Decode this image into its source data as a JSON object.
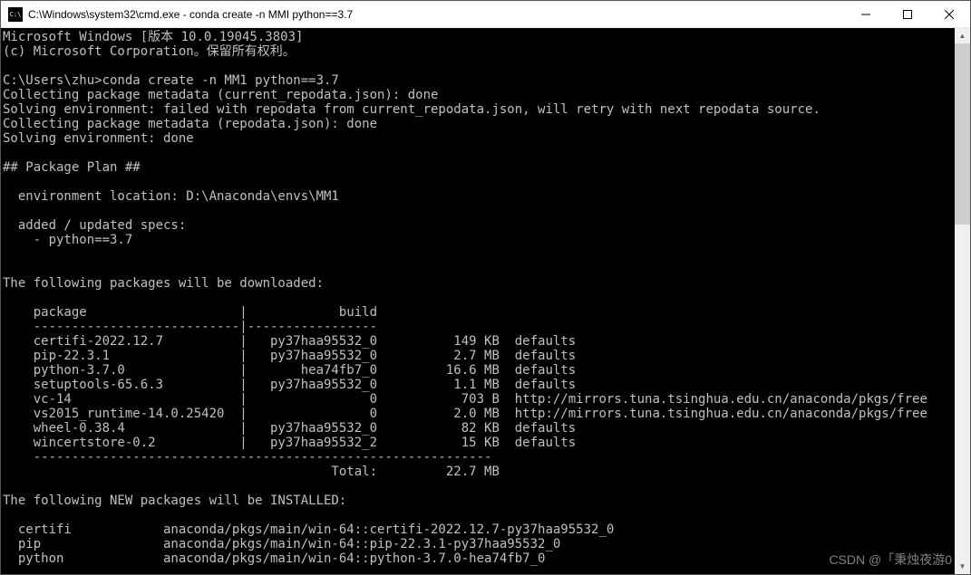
{
  "window": {
    "title": "C:\\Windows\\system32\\cmd.exe - conda  create -n MMI python==3.7",
    "icon_label": "cmd-icon"
  },
  "header": {
    "line1": "Microsoft Windows [版本 10.0.19045.3803]",
    "line2": "(c) Microsoft Corporation。保留所有权利。"
  },
  "prompt": {
    "path": "C:\\Users\\zhu>",
    "command": "conda create -n MM1 python==3.7"
  },
  "collecting": {
    "l1": "Collecting package metadata (current_repodata.json): done",
    "l2": "Solving environment: failed with repodata from current_repodata.json, will retry with next repodata source.",
    "l3": "Collecting package metadata (repodata.json): done",
    "l4": "Solving environment: done"
  },
  "plan": {
    "header": "## Package Plan ##",
    "env_loc_label": "  environment location: D:\\Anaconda\\envs\\MM1",
    "added_label": "  added / updated specs:",
    "spec1": "    - python==3.7"
  },
  "downloads": {
    "header": "The following packages will be downloaded:",
    "col_package": "package",
    "col_build": "build",
    "rows": [
      {
        "pkg": "certifi-2022.12.7",
        "build": "py37haa95532_0",
        "size": "149 KB",
        "channel": "defaults"
      },
      {
        "pkg": "pip-22.3.1",
        "build": "py37haa95532_0",
        "size": "2.7 MB",
        "channel": "defaults"
      },
      {
        "pkg": "python-3.7.0",
        "build": "hea74fb7_0",
        "size": "16.6 MB",
        "channel": "defaults"
      },
      {
        "pkg": "setuptools-65.6.3",
        "build": "py37haa95532_0",
        "size": "1.1 MB",
        "channel": "defaults"
      },
      {
        "pkg": "vc-14",
        "build": "0",
        "size": "703 B",
        "channel": "http://mirrors.tuna.tsinghua.edu.cn/anaconda/pkgs/free"
      },
      {
        "pkg": "vs2015_runtime-14.0.25420",
        "build": "0",
        "size": "2.0 MB",
        "channel": "http://mirrors.tuna.tsinghua.edu.cn/anaconda/pkgs/free"
      },
      {
        "pkg": "wheel-0.38.4",
        "build": "py37haa95532_0",
        "size": "82 KB",
        "channel": "defaults"
      },
      {
        "pkg": "wincertstore-0.2",
        "build": "py37haa95532_2",
        "size": "15 KB",
        "channel": "defaults"
      }
    ],
    "total_label": "Total:",
    "total_value": "22.7 MB"
  },
  "installed": {
    "header": "The following NEW packages will be INSTALLED:",
    "rows": [
      {
        "name": "certifi",
        "spec": "anaconda/pkgs/main/win-64::certifi-2022.12.7-py37haa95532_0"
      },
      {
        "name": "pip",
        "spec": "anaconda/pkgs/main/win-64::pip-22.3.1-py37haa95532_0"
      },
      {
        "name": "python",
        "spec": "anaconda/pkgs/main/win-64::python-3.7.0-hea74fb7_0"
      }
    ]
  },
  "watermark": "CSDN @「秉烛夜游0"
}
